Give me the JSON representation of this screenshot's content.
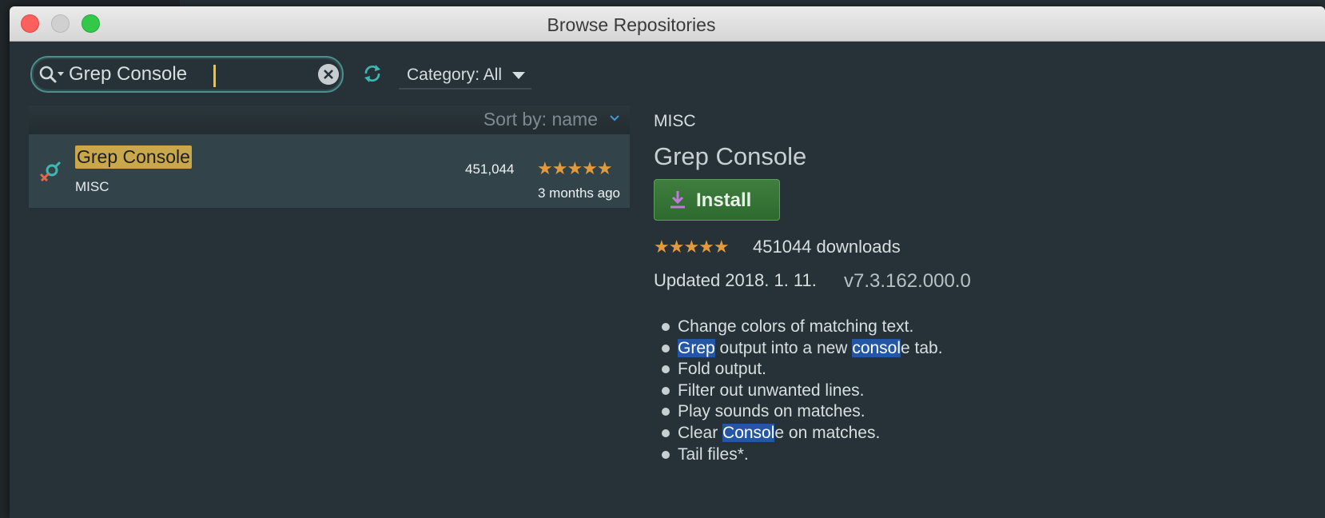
{
  "window": {
    "title": "Browse Repositories"
  },
  "toolbar": {
    "search_value": "Grep Console",
    "category_label": "Category: All"
  },
  "list": {
    "sort_label": "Sort by: name",
    "items": [
      {
        "name": "Grep Console",
        "category": "MISC",
        "downloads": "451,044",
        "rating_stars": "★★★★★",
        "updated": "3 months ago"
      }
    ]
  },
  "detail": {
    "category": "MISC",
    "name": "Grep Console",
    "install_label": "Install",
    "rating_stars": "★★★★★",
    "downloads": "451044 downloads",
    "updated": "Updated 2018. 1. 11.",
    "version": "v7.3.162.000.0",
    "features": [
      {
        "parts": [
          {
            "text": "Change colors of matching text.",
            "hl": false
          }
        ]
      },
      {
        "parts": [
          {
            "text": "Grep",
            "hl": true
          },
          {
            "text": " output into a new ",
            "hl": false
          },
          {
            "text": "consol",
            "hl": true
          },
          {
            "text": "e tab.",
            "hl": false
          }
        ]
      },
      {
        "parts": [
          {
            "text": "Fold output.",
            "hl": false
          }
        ]
      },
      {
        "parts": [
          {
            "text": "Filter out unwanted lines.",
            "hl": false
          }
        ]
      },
      {
        "parts": [
          {
            "text": "Play sounds on matches.",
            "hl": false
          }
        ]
      },
      {
        "parts": [
          {
            "text": "Clear ",
            "hl": false
          },
          {
            "text": "Consol",
            "hl": true
          },
          {
            "text": "e on matches.",
            "hl": false
          }
        ]
      },
      {
        "parts": [
          {
            "text": "Tail files*.",
            "hl": false
          }
        ]
      }
    ]
  },
  "colors": {
    "background": "#263238",
    "selected_row": "#324449",
    "name_highlight": "#c9a84b",
    "text_highlight": "#2357a6",
    "stars": "#e29a3c",
    "install_button": "#3f7e3f",
    "search_border": "#4e8e8e",
    "caret": "#f5c518"
  }
}
